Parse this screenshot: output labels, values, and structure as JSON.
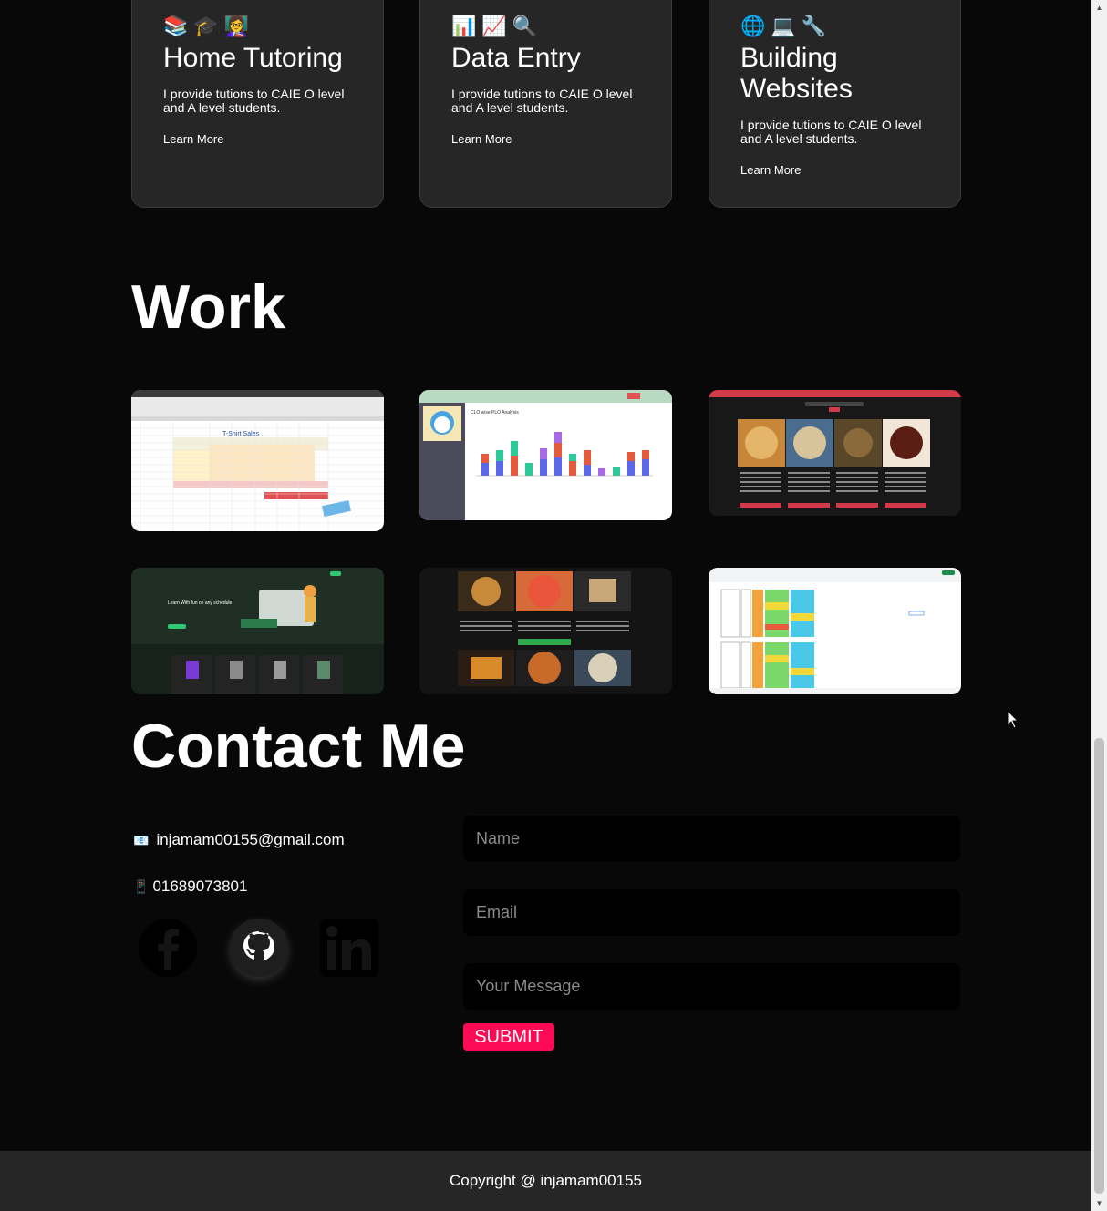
{
  "services": [
    {
      "icons": "📚🎓👩‍🏫",
      "title": "Home Tutoring",
      "desc": "I provide tutions to CAIE O level and A level students.",
      "link": "Learn More"
    },
    {
      "icons": "📊📈🔍",
      "title": "Data Entry",
      "desc": "I provide tutions to CAIE O level and A level students.",
      "link": "Learn More"
    },
    {
      "icons": "🌐💻🔧",
      "title": "Building Websites",
      "desc": "I provide tutions to CAIE O level and A level students.",
      "link": "Learn More"
    }
  ],
  "work": {
    "heading": "Work",
    "items": [
      {
        "name": "T-Shirt Sales spreadsheet",
        "caption": "T-Shirt Sales"
      },
      {
        "name": "Student Performance Monitoring System",
        "caption": "CLO wise PLO Analysis"
      },
      {
        "name": "Food menu website",
        "caption": ""
      },
      {
        "name": "Learning platform website",
        "caption": "Learn With fun on any schedule"
      },
      {
        "name": "Food items website",
        "caption": ""
      },
      {
        "name": "Google Sheets schedule",
        "caption": ""
      }
    ]
  },
  "contact": {
    "heading": "Contact Me",
    "email_icon": "📧",
    "email": "injamam00155@gmail.com",
    "phone_icon": "📱",
    "phone": "01689073801",
    "form": {
      "name_placeholder": "Name",
      "email_placeholder": "Email",
      "message_placeholder": "Your Message",
      "submit_label": "SUBMIT"
    }
  },
  "footer": {
    "text": "Copyright @ injamam00155"
  },
  "colors": {
    "accent": "#ff0a54",
    "card": "#262626",
    "background": "#080808"
  }
}
